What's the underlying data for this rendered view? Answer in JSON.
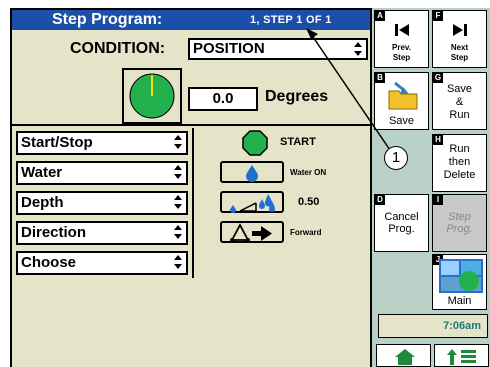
{
  "header": {
    "title": "Step Program:",
    "step_info": "1, STEP  1  OF  1"
  },
  "condition": {
    "label": "CONDITION:",
    "value": "POSITION",
    "degrees_value": "0.0",
    "degrees_label": "Degrees"
  },
  "rows": [
    {
      "select": "Start/Stop",
      "value": "START",
      "icon": "start-circle-icon"
    },
    {
      "select": "Water",
      "value": "Water ON",
      "icon": "water-drop-icon"
    },
    {
      "select": "Depth",
      "value": "0.50",
      "icon": "depth-icon"
    },
    {
      "select": "Direction",
      "value": "Forward",
      "icon": "direction-forward-icon"
    },
    {
      "select": "Choose",
      "value": "",
      "icon": ""
    }
  ],
  "sidebar": {
    "prev": {
      "key": "A",
      "label_1": "Prev.",
      "label_2": "Step"
    },
    "next": {
      "key": "F",
      "label_1": "Next",
      "label_2": "Step"
    },
    "save_icon": {
      "key": "B",
      "label": "Save"
    },
    "save": {
      "key": "G",
      "label_1": "Save",
      "label_2": "&",
      "label_3": "Run"
    },
    "run_delete": {
      "key": "H",
      "label_1": "Run",
      "label_2": "then",
      "label_3": "Delete"
    },
    "cancel": {
      "key": "D",
      "label_1": "Cancel",
      "label_2": "Prog."
    },
    "step_prog": {
      "key": "I",
      "label_1": "Step",
      "label_2": "Prog."
    },
    "main": {
      "key": "J",
      "label": "Main"
    }
  },
  "status": {
    "time": "7:06am"
  },
  "callout": {
    "number": "1"
  },
  "colors": {
    "title_bar": "#1c4fa8",
    "panel": "#e6e4c8",
    "sidebar": "#b9d0c7",
    "accent_green": "#22b14c",
    "water_blue": "#1f6fd0"
  }
}
